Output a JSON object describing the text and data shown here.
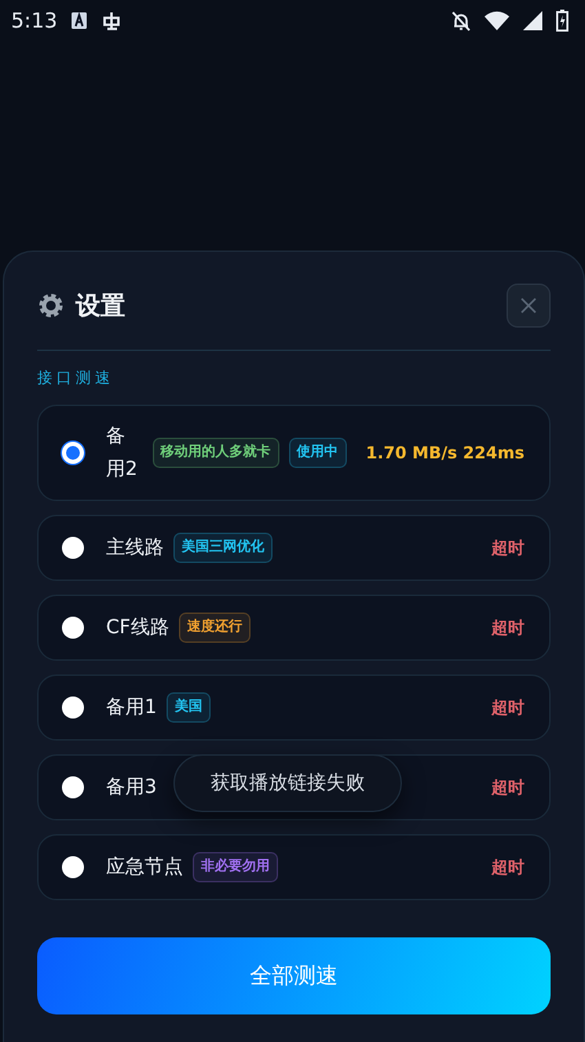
{
  "status_bar": {
    "time": "5:13"
  },
  "sheet": {
    "title": "设置",
    "section_label": "接口测速",
    "lines": [
      {
        "name": "备用2",
        "selected": true,
        "tags": [
          {
            "label": "移动用的人多就卡",
            "color": "#6fcf7a"
          },
          {
            "label": "使用中",
            "color": "#22c3f0"
          }
        ],
        "result": {
          "text": "1.70 MB/s 224ms",
          "kind": "speed"
        }
      },
      {
        "name": "主线路",
        "selected": false,
        "tags": [
          {
            "label": "美国三网优化",
            "color": "#22c3f0"
          }
        ],
        "result": {
          "text": "超时",
          "kind": "timeout"
        }
      },
      {
        "name": "CF线路",
        "selected": false,
        "tags": [
          {
            "label": "速度还行",
            "color": "#f0a030"
          }
        ],
        "result": {
          "text": "超时",
          "kind": "timeout"
        }
      },
      {
        "name": "备用1",
        "selected": false,
        "tags": [
          {
            "label": "美国",
            "color": "#22c3f0"
          }
        ],
        "result": {
          "text": "超时",
          "kind": "timeout"
        }
      },
      {
        "name": "备用3",
        "selected": false,
        "result": {
          "text": "超时",
          "kind": "timeout"
        }
      },
      {
        "name": "应急节点",
        "selected": false,
        "tags": [
          {
            "label": "非必要勿用",
            "color": "#a070f0"
          }
        ],
        "result": {
          "text": "超时",
          "kind": "timeout"
        }
      }
    ],
    "test_all_button": "全部测速"
  },
  "toast": "获取播放链接失败"
}
